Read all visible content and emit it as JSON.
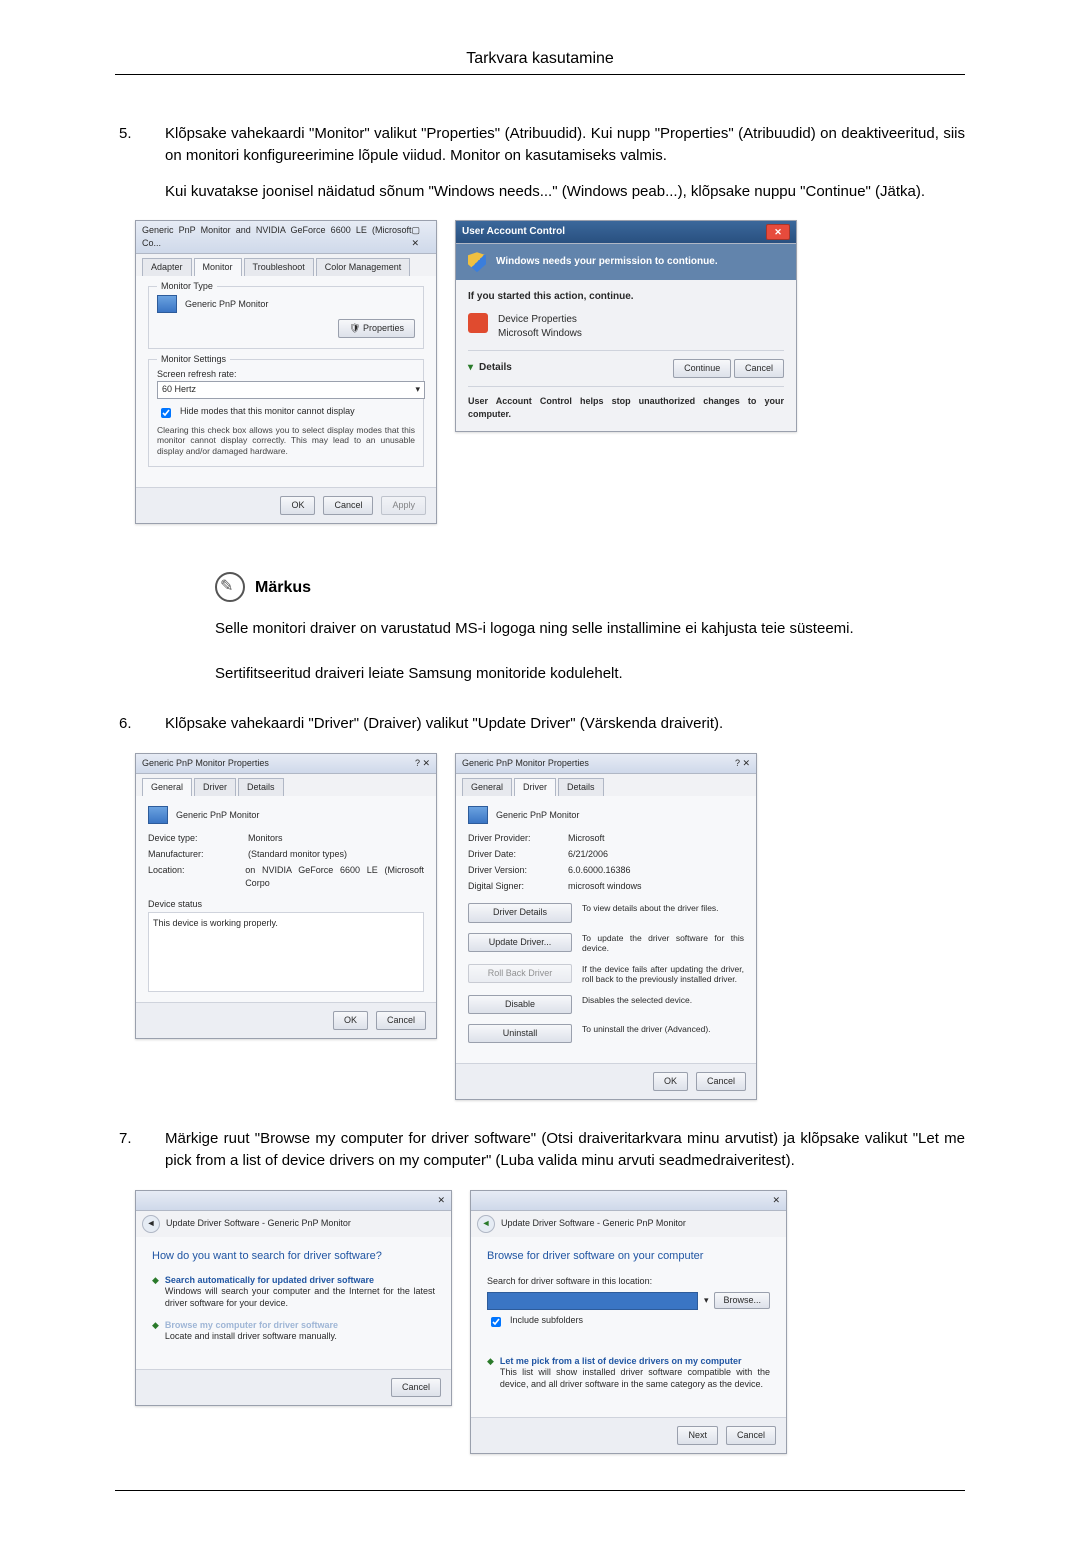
{
  "header": {
    "title": "Tarkvara kasutamine"
  },
  "step5": {
    "text": "Klõpsake vahekaardi \"Monitor\" valikut \"Properties\" (Atribuudid). Kui nupp \"Properties\" (Atribuudid) on deaktiveeritud, siis on monitori konfigureerimine lõpule viidud. Monitor on kasutamiseks valmis.",
    "para": "Kui kuvatakse joonisel näidatud sõnum \"Windows needs...\" (Windows peab...), klõpsake nuppu \"Continue\" (Jätka)."
  },
  "fig1": {
    "title": "Generic PnP Monitor and NVIDIA GeForce 6600 LE (Microsoft Co...",
    "tabs": [
      "Adapter",
      "Monitor",
      "Troubleshoot",
      "Color Management"
    ],
    "gb1": "Monitor Type",
    "monName": "Generic PnP Monitor",
    "propBtn": "Properties",
    "gb2": "Monitor Settings",
    "refreshLabel": "Screen refresh rate:",
    "refreshValue": "60 Hertz",
    "hideLabel": "Hide modes that this monitor cannot display",
    "hideHint": "Clearing this check box allows you to select display modes that this monitor cannot display correctly. This may lead to an unusable display and/or damaged hardware.",
    "ok": "OK",
    "cancel": "Cancel",
    "apply": "Apply"
  },
  "fig2": {
    "title": "User Account Control",
    "banner": "Windows needs your permission to contionue.",
    "ifStarted": "If you started this action, continue.",
    "devProp": "Device Properties",
    "msWin": "Microsoft Windows",
    "details": "Details",
    "continue": "Continue",
    "cancel": "Cancel",
    "footerNote": "User Account Control helps stop unauthorized changes to your computer."
  },
  "note": {
    "title": "Märkus",
    "p1": "Selle monitori draiver on varustatud MS-i logoga ning selle installimine ei kahjusta teie süsteemi.",
    "p2": "Sertifitseeritud draiveri leiate Samsung monitoride kodulehelt."
  },
  "step6": {
    "text": "Klõpsake vahekaardi \"Driver\" (Draiver) valikut \"Update Driver\" (Värskenda draiverit)."
  },
  "fig3": {
    "title": "Generic PnP Monitor Properties",
    "tabs": [
      "General",
      "Driver",
      "Details"
    ],
    "monName": "Generic PnP Monitor",
    "kv": {
      "deviceType": "Device type:",
      "deviceTypeV": "Monitors",
      "manufacturer": "Manufacturer:",
      "manufacturerV": "(Standard monitor types)",
      "location": "Location:",
      "locationV": "on NVIDIA GeForce 6600 LE (Microsoft Corpo"
    },
    "statusLabel": "Device status",
    "statusText": "This device is working properly.",
    "ok": "OK",
    "cancel": "Cancel"
  },
  "fig4": {
    "title": "Generic PnP Monitor Properties",
    "tabs": [
      "General",
      "Driver",
      "Details"
    ],
    "monName": "Generic PnP Monitor",
    "kv": {
      "provider": "Driver Provider:",
      "providerV": "Microsoft",
      "date": "Driver Date:",
      "dateV": "6/21/2006",
      "version": "Driver Version:",
      "versionV": "6.0.6000.16386",
      "signer": "Digital Signer:",
      "signerV": "microsoft windows"
    },
    "actions": {
      "details": "Driver Details",
      "detailsDesc": "To view details about the driver files.",
      "update": "Update Driver...",
      "updateDesc": "To update the driver software for this device.",
      "rollback": "Roll Back Driver",
      "rollbackDesc": "If the device fails after updating the driver, roll back to the previously installed driver.",
      "disable": "Disable",
      "disableDesc": "Disables the selected device.",
      "uninstall": "Uninstall",
      "uninstallDesc": "To uninstall the driver (Advanced)."
    },
    "ok": "OK",
    "cancel": "Cancel"
  },
  "step7": {
    "text": "Märkige ruut \"Browse my computer for driver software\" (Otsi draiveritarkvara minu arvutist) ja klõpsake valikut \"Let me pick from a list of device drivers on my computer\" (Luba valida minu arvuti seadmedraiveritest)."
  },
  "fig5": {
    "breadcrumb": "Update Driver Software - Generic PnP Monitor",
    "heading": "How do you want to search for driver software?",
    "opt1": "Search automatically for updated driver software",
    "opt1desc": "Windows will search your computer and the Internet for the latest driver software for your device.",
    "opt2": "Browse my computer for driver software",
    "opt2desc": "Locate and install driver software manually.",
    "cancel": "Cancel"
  },
  "fig6": {
    "breadcrumb": "Update Driver Software - Generic PnP Monitor",
    "heading": "Browse for driver software on your computer",
    "searchLabel": "Search for driver software in this location:",
    "browse": "Browse...",
    "include": "Include subfolders",
    "opt3": "Let me pick from a list of device drivers on my computer",
    "opt3desc": "This list will show installed driver software compatible with the device, and all driver software in the same category as the device.",
    "next": "Next",
    "cancel": "Cancel"
  }
}
